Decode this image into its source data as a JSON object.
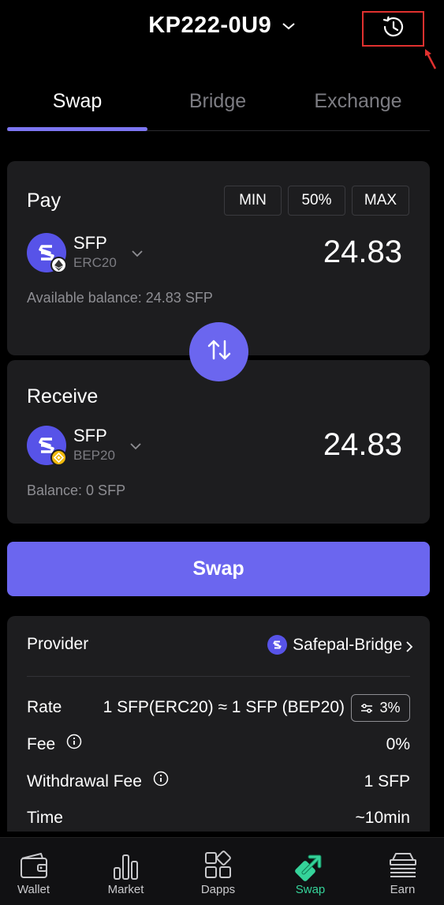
{
  "header": {
    "wallet_name": "KP222-0U9"
  },
  "tabs": [
    {
      "label": "Swap",
      "active": true
    },
    {
      "label": "Bridge",
      "active": false
    },
    {
      "label": "Exchange",
      "active": false
    }
  ],
  "pay": {
    "label": "Pay",
    "quick_buttons": [
      "MIN",
      "50%",
      "MAX"
    ],
    "token": "SFP",
    "network": "ERC20",
    "network_icon": "ethereum-icon",
    "amount": "24.83",
    "balance_text": "Available balance: 24.83 SFP"
  },
  "receive": {
    "label": "Receive",
    "token": "SFP",
    "network": "BEP20",
    "network_icon": "bnb-icon",
    "amount": "24.83",
    "balance_text": "Balance: 0 SFP"
  },
  "swap_button": "Swap",
  "details": {
    "provider_label": "Provider",
    "provider_value": "Safepal-Bridge",
    "rate_label": "Rate",
    "rate_value": "1 SFP(ERC20) ≈ 1 SFP (BEP20)",
    "slippage": "3%",
    "fee_label": "Fee",
    "fee_value": "0%",
    "withdrawal_fee_label": "Withdrawal Fee",
    "withdrawal_fee_value": "1 SFP",
    "time_label": "Time",
    "time_value": "~10min"
  },
  "nav": [
    {
      "label": "Wallet",
      "icon": "wallet-icon",
      "active": false
    },
    {
      "label": "Market",
      "icon": "market-icon",
      "active": false
    },
    {
      "label": "Dapps",
      "icon": "dapps-icon",
      "active": false
    },
    {
      "label": "Swap",
      "icon": "swap-icon",
      "active": true
    },
    {
      "label": "Earn",
      "icon": "earn-icon",
      "active": false
    }
  ],
  "colors": {
    "accent": "#6b66ef",
    "active_nav": "#35d39a",
    "highlight_box": "#e0312f",
    "card_bg": "#1d1d1f"
  }
}
